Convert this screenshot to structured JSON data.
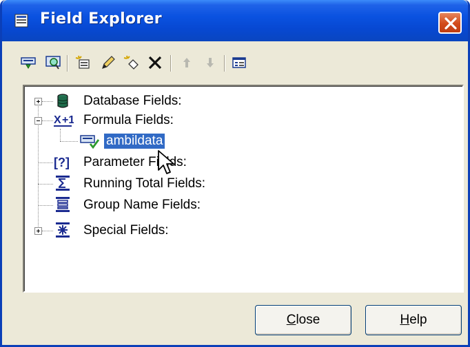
{
  "window": {
    "title": "Field Explorer"
  },
  "toolbar": {
    "items": [
      "insert-to-report-icon",
      "browse-icon",
      "new-icon",
      "edit-icon",
      "rename-icon",
      "delete-icon",
      "move-up-icon",
      "move-down-icon",
      "properties-icon"
    ]
  },
  "tree": {
    "nodes": [
      {
        "label": "Database Fields:",
        "icon": "database-icon",
        "expander": "plus"
      },
      {
        "label": "Formula Fields:",
        "icon": "formula-icon",
        "expander": "minus"
      },
      {
        "label": "ambildata",
        "icon": "formula-field-icon",
        "selected": true
      },
      {
        "label": "Parameter Fields:",
        "icon": "parameter-icon"
      },
      {
        "label": "Running Total Fields:",
        "icon": "running-total-icon"
      },
      {
        "label": "Group Name Fields:",
        "icon": "group-name-icon"
      },
      {
        "label": "Special Fields:",
        "icon": "special-fields-icon",
        "expander": "plus"
      }
    ]
  },
  "buttons": {
    "close": {
      "mnemonic": "C",
      "rest": "lose"
    },
    "help": {
      "mnemonic": "H",
      "rest": "elp"
    }
  },
  "colors": {
    "titlebar": "#0a52e0",
    "selection": "#316ac5",
    "close_button": "#d24a1a",
    "dialog_bg": "#ece9d8"
  }
}
